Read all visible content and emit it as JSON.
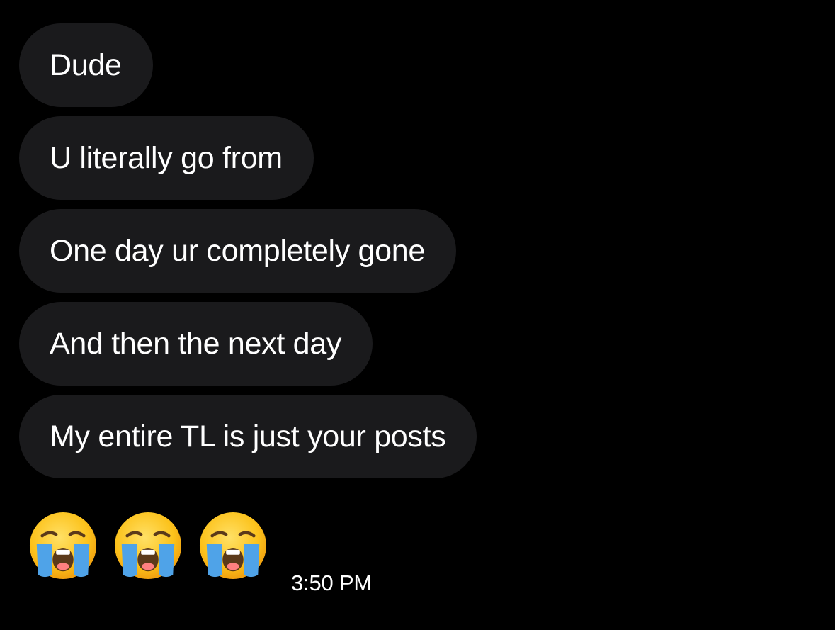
{
  "messages": [
    {
      "text": "Dude"
    },
    {
      "text": "U literally go from"
    },
    {
      "text": "One day ur completely gone"
    },
    {
      "text": "And then the next day"
    },
    {
      "text": "My entire TL is just your posts"
    }
  ],
  "emojis": [
    {
      "icon": "loudly-crying-face-emoji"
    },
    {
      "icon": "loudly-crying-face-emoji"
    },
    {
      "icon": "loudly-crying-face-emoji"
    }
  ],
  "timestamp": "3:50 PM",
  "colors": {
    "background": "#000000",
    "bubble": "#1a1a1c",
    "text": "#ffffff",
    "emoji_face": "#fcc21b",
    "emoji_tears": "#4fa3e8"
  }
}
